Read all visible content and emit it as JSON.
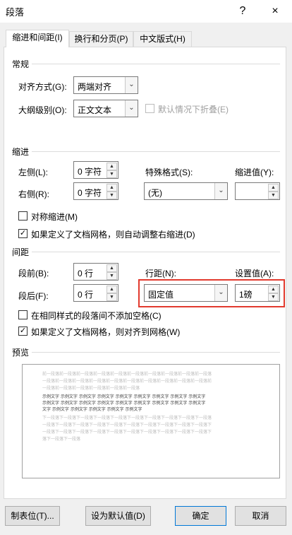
{
  "window": {
    "title": "段落",
    "help": "?",
    "close": "×"
  },
  "tabs": [
    {
      "label": "缩进和间距(I)",
      "active": true
    },
    {
      "label": "换行和分页(P)",
      "active": false
    },
    {
      "label": "中文版式(H)",
      "active": false
    }
  ],
  "general": {
    "heading": "常规",
    "alignment_label": "对齐方式(G):",
    "alignment_value": "两端对齐",
    "outline_label": "大纲级别(O):",
    "outline_value": "正文文本",
    "collapse_label": "默认情况下折叠(E)"
  },
  "indent": {
    "heading": "缩进",
    "left_label": "左侧(L):",
    "left_value": "0 字符",
    "right_label": "右侧(R):",
    "right_value": "0 字符",
    "special_label": "特殊格式(S):",
    "special_value": "(无)",
    "indent_value_label": "缩进值(Y):",
    "indent_value": "",
    "mirror_label": "对称缩进(M)",
    "auto_adjust_label": "如果定义了文档网格，则自动调整右缩进(D)"
  },
  "spacing": {
    "heading": "间距",
    "before_label": "段前(B):",
    "before_value": "0 行",
    "after_label": "段后(F):",
    "after_value": "0 行",
    "line_spacing_label": "行距(N):",
    "line_spacing_value": "固定值",
    "at_label": "设置值(A):",
    "at_value": "1磅",
    "no_space_label": "在相同样式的段落间不添加空格(C)",
    "snap_grid_label": "如果定义了文档网格，则对齐到网格(W)"
  },
  "preview": {
    "heading": "预览",
    "prev_lines": [
      "前一段落前一段落前一段落前一段落前一段落前一段落前一段落前一段落前一段落前一段落",
      "一段落前一段落前一段落前一段落前一段落前一段落前一段落前一段落前一段落前一段落前",
      "一段落前一段落前一段落前一段落前一段落前一段落"
    ],
    "sample_lines": [
      "示例文字 示例文字 示例文字 示例文字 示例文字 示例文字 示例文字 示例文字 示例文字",
      "示例文字 示例文字 示例文字 示例文字 示例文字 示例文字 示例文字 示例文字 示例文字",
      "文字 示例文字 示例文字 示例文字 示例文字 示例文字"
    ],
    "next_lines": [
      "下一段落下一段落下一段落下一段落下一段落下一段落下一段落下一段落下一段落下一段落",
      "一段落下一段落下一段落下一段落下一段落下一段落下一段落下一段落下一段落下一段落下",
      "一段落下一段落下一段落下一段落下一段落下一段落下一段落下一段落下一段落下一段落下",
      "落下一段落下一段落"
    ]
  },
  "buttons": {
    "tabs": "制表位(T)...",
    "set_default": "设为默认值(D)",
    "ok": "确定",
    "cancel": "取消"
  },
  "colors": {
    "highlight": "#e23a2e",
    "default_button_border": "#0078d7"
  }
}
